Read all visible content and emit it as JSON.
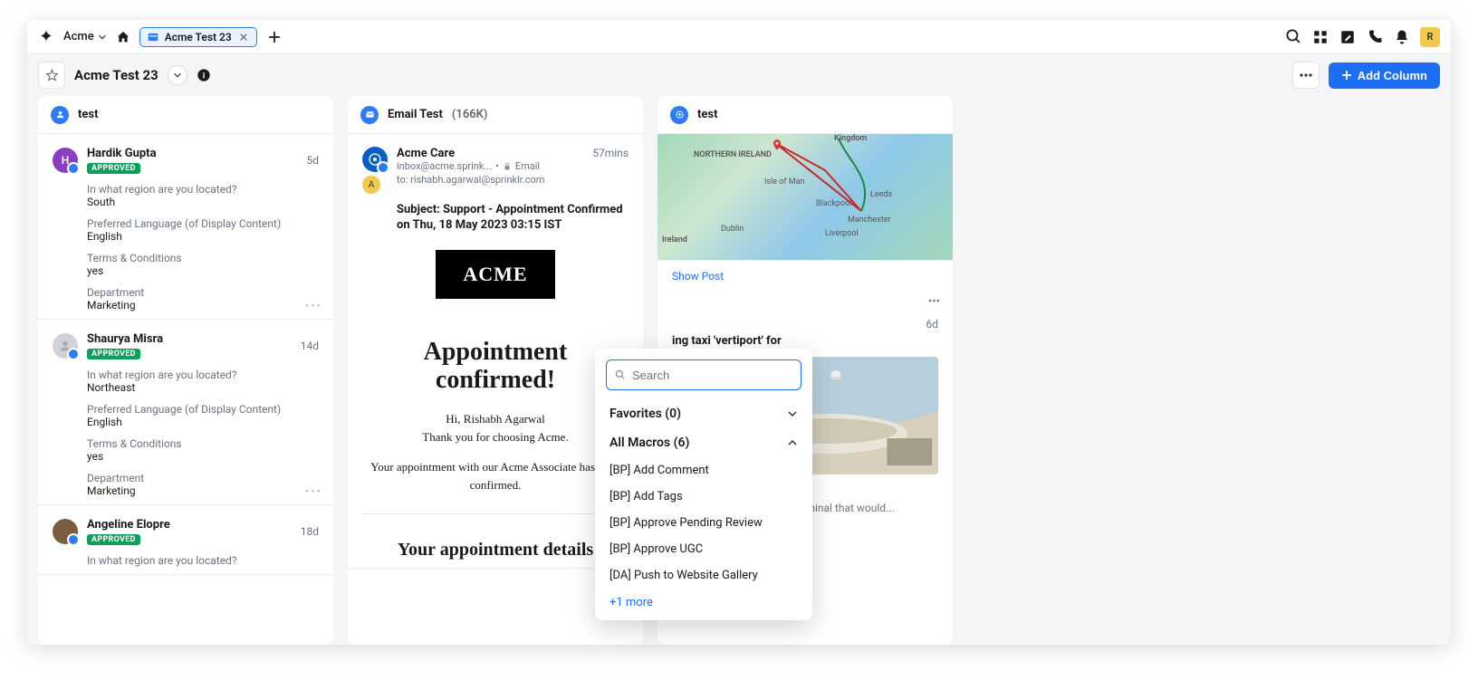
{
  "topbar": {
    "workspace": "Acme",
    "tab_label": "Acme Test 23",
    "user_initial": "R"
  },
  "subheader": {
    "title": "Acme Test 23",
    "add_column_label": "Add Column"
  },
  "columns": [
    {
      "title": "test",
      "cards": [
        {
          "name": "Hardik Gupta",
          "badge": "APPROVED",
          "time": "5d",
          "initial": "H",
          "fields": [
            {
              "label": "In what region are you located?",
              "value": "South"
            },
            {
              "label": "Preferred Language (of Display Content)",
              "value": "English"
            },
            {
              "label": "Terms & Conditions",
              "value": "yes"
            },
            {
              "label": "Department",
              "value": "Marketing"
            }
          ]
        },
        {
          "name": "Shaurya Misra",
          "badge": "APPROVED",
          "time": "14d",
          "initial": "",
          "fields": [
            {
              "label": "In what region are you located?",
              "value": "Northeast"
            },
            {
              "label": "Preferred Language (of Display Content)",
              "value": "English"
            },
            {
              "label": "Terms & Conditions",
              "value": "yes"
            },
            {
              "label": "Department",
              "value": "Marketing"
            }
          ]
        },
        {
          "name": "Angeline Elopre",
          "badge": "APPROVED",
          "time": "18d",
          "initial": "",
          "fields": [
            {
              "label": "In what region are you located?",
              "value": ""
            }
          ]
        }
      ]
    },
    {
      "title": "Email Test",
      "count": "(166K)",
      "email": {
        "from_name": "Acme Care",
        "from_address": "inbox@acme.sprink...",
        "channel": "Email",
        "to_prefix": "to:",
        "to_address": "rishabh.agarwal@sprinklr.com",
        "time": "57mins",
        "subject": "Subject: Support - Appointment Confirmed on Thu, 18 May 2023 03:15 IST",
        "brand": "ACME",
        "heading": "Appointment confirmed!",
        "greeting": "Hi, Rishabh Agarwal",
        "thank": "Thank you for choosing Acme.",
        "body": "Your appointment with our Acme Associate has been confirmed.",
        "details_heading": "Your appointment details"
      }
    },
    {
      "title": "test",
      "map": {
        "labels": {
          "kingdom": "Kingdom",
          "northern_ireland": "NORTHERN IRELAND",
          "isle_of_man": "Isle of Man",
          "ireland": "Ireland",
          "dublin": "Dublin",
          "liverpool": "Liverpool",
          "manchester": "Manchester",
          "leeds": "Leeds",
          "blackpool": "Blackpool"
        },
        "show_post": "Show Post"
      },
      "article": {
        "time": "6d",
        "headline_partial": "ing taxi 'vertiport' for",
        "headline_below": "ying taxi 'vertiport' for",
        "desc": "has released a concept \" terminal that would..."
      }
    }
  ],
  "popup": {
    "search_placeholder": "Search",
    "favorites_label": "Favorites (0)",
    "all_macros_label": "All Macros (6)",
    "items": [
      "[BP] Add Comment",
      "[BP] Add Tags",
      "[BP] Approve Pending Review",
      "[BP] Approve UGC",
      "[DA] Push to Website Gallery"
    ],
    "more_label": "+1 more"
  }
}
